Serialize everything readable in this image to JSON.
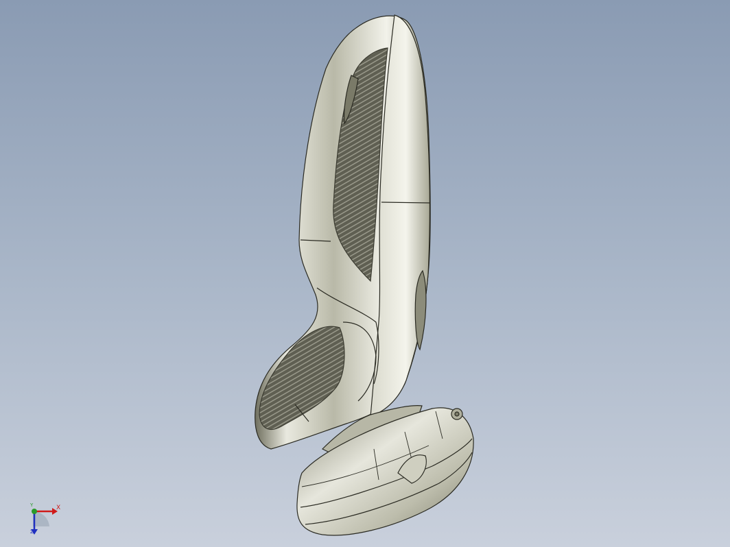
{
  "viewport": {
    "background_top": "#8a9bb3",
    "background_bottom": "#c9d0dc",
    "model_color": "#c8c8b8",
    "model_name": "shaver-body-icon"
  },
  "triad": {
    "x_label": "X",
    "y_label": "Y",
    "z_label": "Z",
    "x_color": "#d01a1a",
    "y_color": "#2a9a2a",
    "z_color": "#2030c0"
  }
}
